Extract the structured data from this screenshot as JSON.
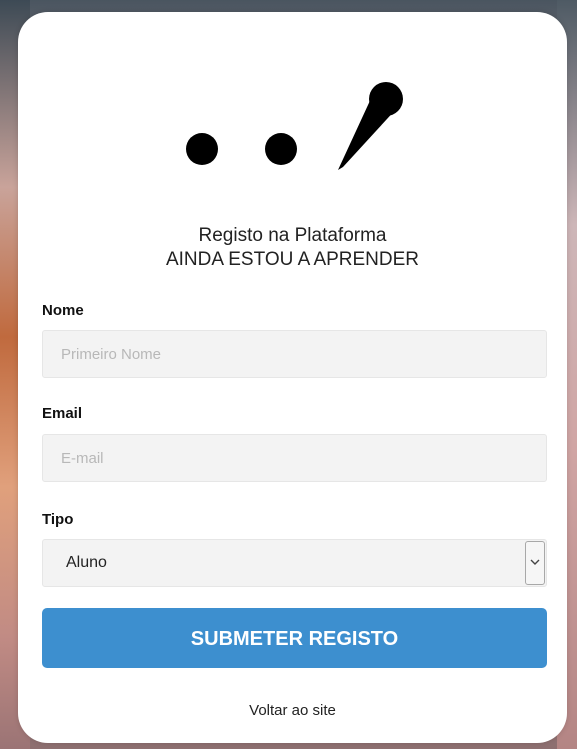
{
  "form": {
    "title_line1": "Registo na Plataforma",
    "title_line2": "AINDA ESTOU A APRENDER",
    "name_label": "Nome",
    "name_placeholder": "Primeiro Nome",
    "name_value": "",
    "email_label": "Email",
    "email_placeholder": "E-mail",
    "email_value": "",
    "type_label": "Tipo",
    "type_selected": "Aluno",
    "submit_label": "SUBMETER REGISTO",
    "back_link": "Voltar ao site"
  },
  "colors": {
    "accent": "#3d8fcf",
    "input_bg": "#f3f3f3",
    "card_bg": "#ffffff"
  },
  "icons": {
    "logo": "two-dots-and-quill-logo",
    "select_arrow": "chevron-down-icon"
  }
}
